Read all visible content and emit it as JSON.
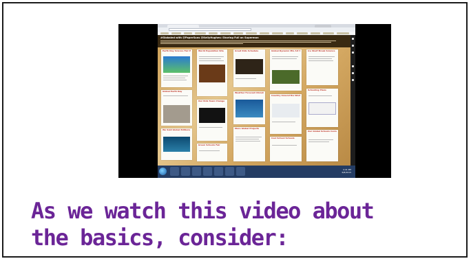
{
  "slide": {
    "caption_line1": "As we watch this video about",
    "caption_line2": "the basics, consider:",
    "caption_color": "#6b2597"
  },
  "video": {
    "padlet_title": "#Globaled with @PaperSuns @KellyHughes: Sharing Full on Superman",
    "taskbar_time": "4:41 PM",
    "taskbar_date": "6/8/2015",
    "posts": [
      {
        "title": "Earth Day Science Fair Projects"
      },
      {
        "title": "World Population Site"
      },
      {
        "title": "Great Kids Schedule"
      },
      {
        "title": "Global Dynamic Mix Art Strategy"
      },
      {
        "title": "Global Earth Day"
      },
      {
        "title": "Ice Shelf Break Science"
      },
      {
        "title": "Our Kids Team Change"
      },
      {
        "title": "Weather Forecast Climate Change"
      },
      {
        "title": "Country Around the World"
      },
      {
        "title": "Schooling Plans"
      },
      {
        "title": "We Said Global Editions"
      },
      {
        "title": "Green Schools Fair"
      },
      {
        "title": "More Global Projects"
      },
      {
        "title": "Cool School Schools"
      },
      {
        "title": "Our Global Schools Connecting"
      }
    ]
  }
}
